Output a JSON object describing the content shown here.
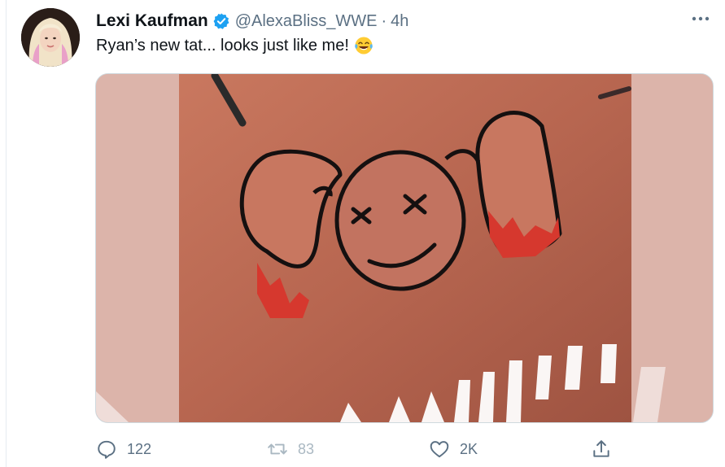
{
  "tweet": {
    "display_name": "Lexi Kaufman",
    "handle": "@AlexaBliss_WWE",
    "separator": "·",
    "time": "4h",
    "text": "Ryan’s new tat... looks just like me!",
    "emoji": "face-with-tears-of-joy"
  },
  "actions": {
    "reply_count": "122",
    "retweet_count": "83",
    "like_count": "2K"
  },
  "colors": {
    "accent": "#1da1f2",
    "muted": "#5b7083",
    "text": "#0f1419"
  }
}
